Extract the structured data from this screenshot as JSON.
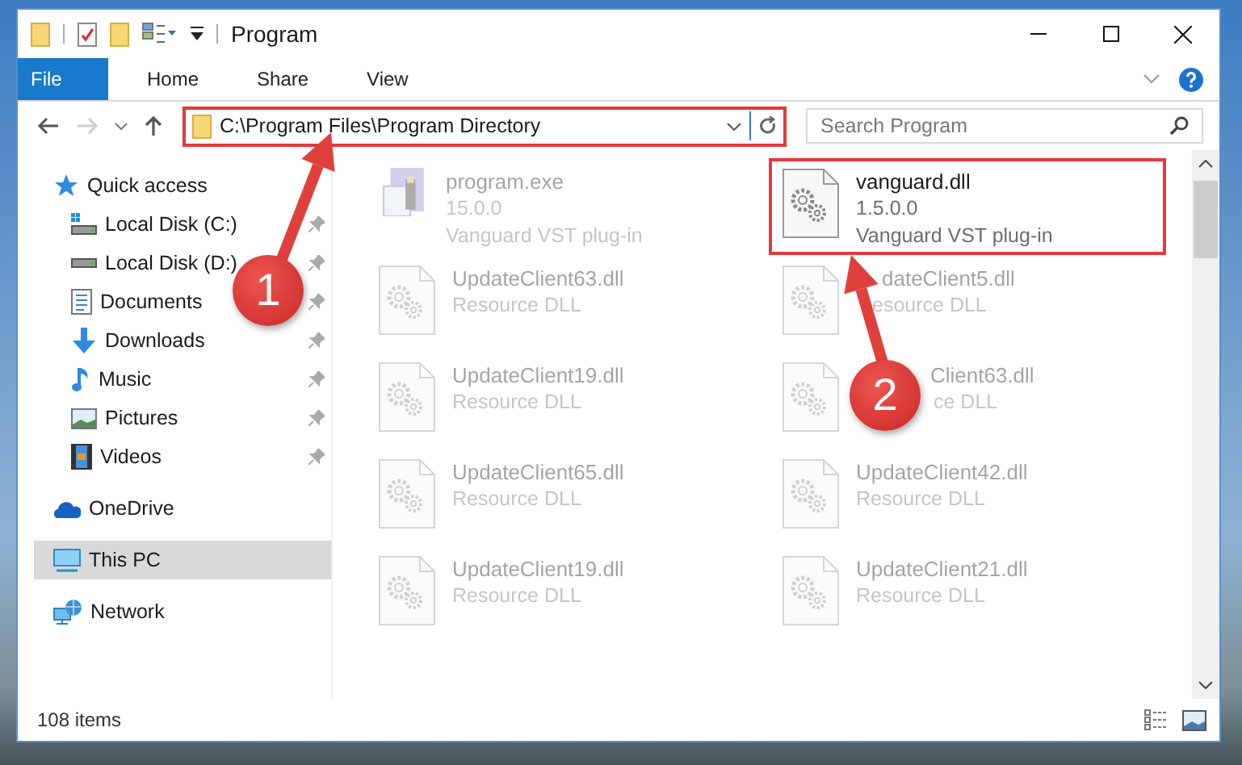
{
  "window": {
    "title": "Program"
  },
  "ribbon": {
    "tabs": [
      {
        "label": "File",
        "kind": "file"
      },
      {
        "label": "Home",
        "kind": "plain"
      },
      {
        "label": "Share",
        "kind": "plain"
      },
      {
        "label": "View",
        "kind": "plain"
      }
    ]
  },
  "address_bar": {
    "value": "C:\\Program Files\\Program Directory",
    "highlighted": true
  },
  "search": {
    "placeholder": "Search Program"
  },
  "sidebar": {
    "items": [
      {
        "label": "Quick access",
        "kind": "star",
        "selected": false,
        "children": [
          {
            "label": "Local Disk (C:)",
            "kind": "drivec",
            "selected": false,
            "pinned": true
          },
          {
            "label": "Local Disk (D:)",
            "kind": "drive",
            "selected": false,
            "pinned": true
          },
          {
            "label": "Documents",
            "kind": "documents",
            "selected": false,
            "pinned": true
          },
          {
            "label": "Downloads",
            "kind": "downloads",
            "selected": false,
            "pinned": true
          },
          {
            "label": "Music",
            "kind": "music",
            "selected": false,
            "pinned": true
          },
          {
            "label": "Pictures",
            "kind": "pictures",
            "selected": false,
            "pinned": true
          },
          {
            "label": "Videos",
            "kind": "videos",
            "selected": false,
            "pinned": true
          }
        ]
      },
      {
        "label": "OneDrive",
        "kind": "cloud",
        "selected": false
      },
      {
        "label": "This PC",
        "kind": "pc",
        "selected": true
      },
      {
        "label": "Network",
        "kind": "network",
        "selected": false
      }
    ]
  },
  "files": [
    {
      "name": "program.exe",
      "lines": [
        "15.0.0",
        "Vanguard VST plug-in"
      ],
      "kind": "exe",
      "highlighted": false
    },
    {
      "name": "vanguard.dll",
      "lines": [
        "1.5.0.0",
        "Vanguard VST plug-in"
      ],
      "kind": "dll",
      "highlighted": true
    },
    {
      "name": "UpdateClient63.dll",
      "lines": [
        "Resource DLL"
      ],
      "kind": "dll",
      "highlighted": false
    },
    {
      "name": "dateClient5.dll",
      "lines": [
        "esource DLL"
      ],
      "kind": "dll",
      "highlighted": false
    },
    {
      "name": "UpdateClient19.dll",
      "lines": [
        "Resource DLL"
      ],
      "kind": "dll",
      "highlighted": false
    },
    {
      "name": "Client63.dll",
      "lines": [
        "ce DLL"
      ],
      "kind": "dll",
      "highlighted": false
    },
    {
      "name": "UpdateClient65.dll",
      "lines": [
        "Resource DLL"
      ],
      "kind": "dll",
      "highlighted": false
    },
    {
      "name": "UpdateClient42.dll",
      "lines": [
        "Resource DLL"
      ],
      "kind": "dll",
      "highlighted": false
    },
    {
      "name": "UpdateClient19.dll",
      "lines": [
        "Resource DLL"
      ],
      "kind": "dll",
      "highlighted": false
    },
    {
      "name": "UpdateClient21.dll",
      "lines": [
        "Resource DLL"
      ],
      "kind": "dll",
      "highlighted": false
    }
  ],
  "status_bar": {
    "text": "108 items"
  },
  "callouts": [
    {
      "number": "1"
    },
    {
      "number": "2"
    }
  ]
}
